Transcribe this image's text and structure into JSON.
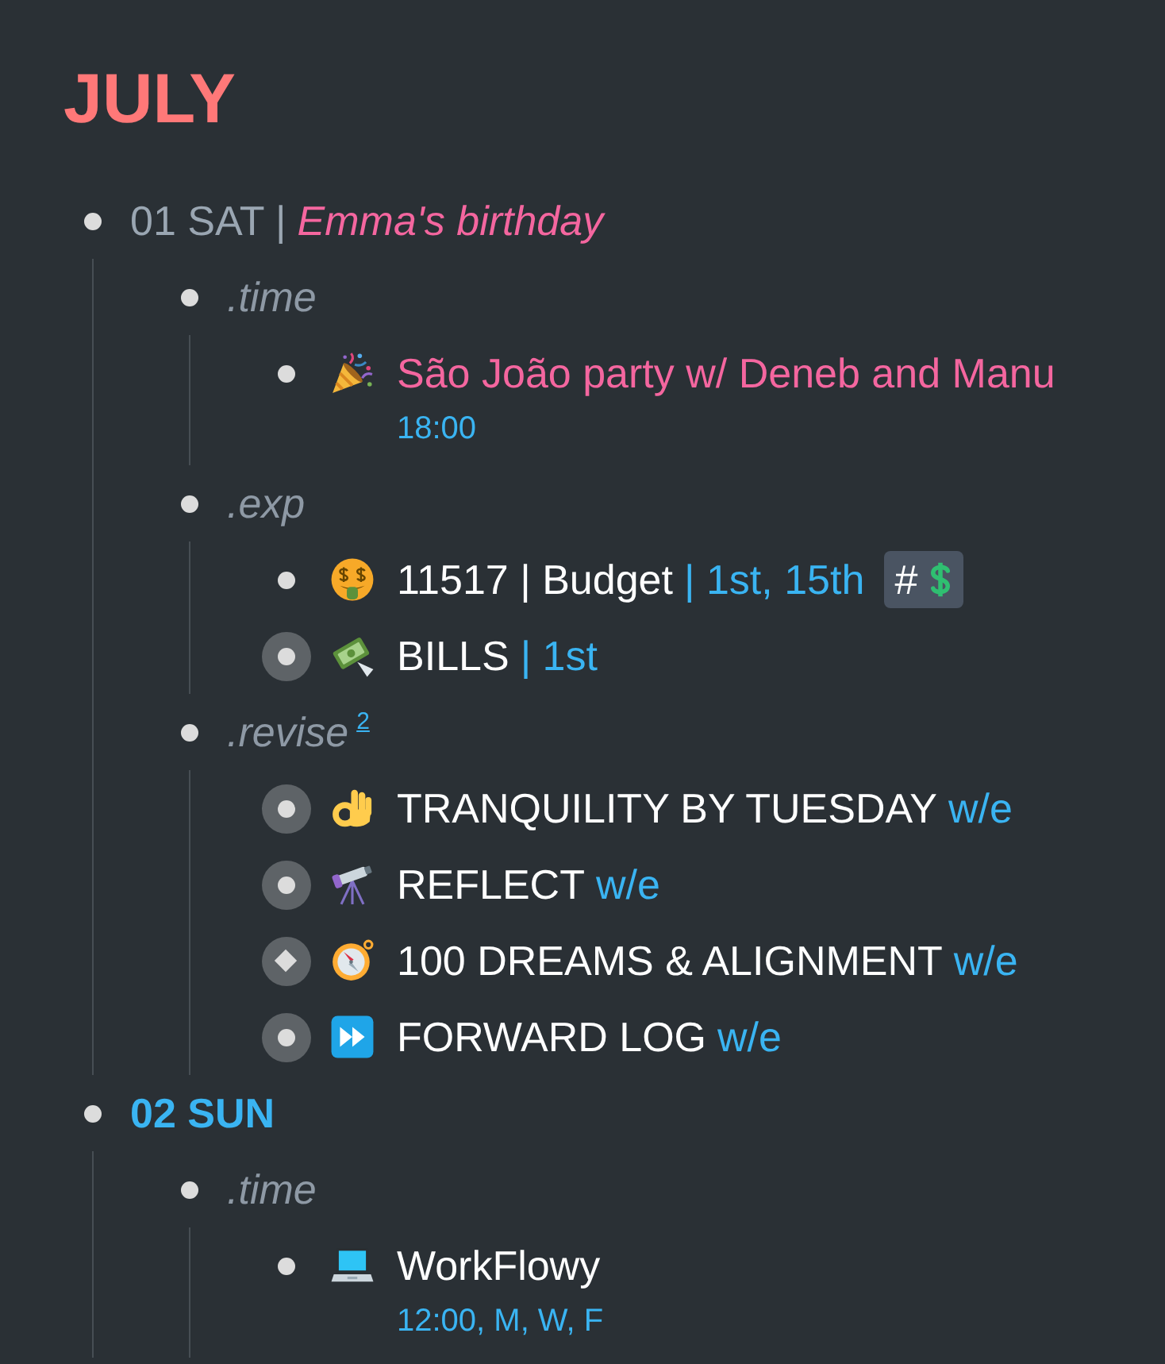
{
  "title": "JULY",
  "items": [
    {
      "kind": "plain",
      "collapsed": false,
      "segments": [
        {
          "kind": "text",
          "text": "01 SAT |",
          "color": "#9aa6b2"
        },
        {
          "kind": "emphasis",
          "text": "Emma's birthday",
          "color": "#f4669f"
        }
      ],
      "children": [
        {
          "kind": "plain",
          "collapsed": false,
          "segments": [
            {
              "kind": "emphasis",
              "text": ".time",
              "color": "#8e99a5"
            }
          ],
          "children": [
            {
              "kind": "plain",
              "collapsed": false,
              "segments": [
                {
                  "kind": "text",
                  "text": "São João party w/ Deneb and Manu",
                  "color": "#f4669f"
                }
              ],
              "note": "18:00"
            }
          ]
        },
        {
          "kind": "plain",
          "collapsed": false,
          "segments": [
            {
              "kind": "emphasis",
              "text": ".exp",
              "color": "#8e99a5"
            }
          ],
          "children": [
            {
              "kind": "plain",
              "collapsed": false,
              "segments": [
                {
                  "kind": "text",
                  "text": "11517 | Budget",
                  "color": "#ffffff"
                },
                {
                  "kind": "text",
                  "text": "| 1st, 15th",
                  "color": "#3ab4f2"
                },
                {
                  "kind": "tag",
                  "text": "#"
                }
              ]
            },
            {
              "kind": "plain",
              "collapsed": true,
              "segments": [
                {
                  "kind": "text",
                  "text": "BILLS",
                  "color": "#ffffff"
                },
                {
                  "kind": "text",
                  "text": "| 1st",
                  "color": "#3ab4f2"
                }
              ]
            }
          ]
        },
        {
          "kind": "plain",
          "collapsed": false,
          "segments": [
            {
              "kind": "emphasis",
              "text": ".revise",
              "color": "#8e99a5"
            },
            {
              "kind": "count",
              "text": "2",
              "color": "#3ab4f2"
            }
          ],
          "children": [
            {
              "kind": "plain",
              "collapsed": true,
              "segments": [
                {
                  "kind": "text",
                  "text": "TRANQUILITY BY TUESDAY",
                  "color": "#ffffff"
                },
                {
                  "kind": "text",
                  "text": "w/e",
                  "color": "#3ab4f2"
                }
              ]
            },
            {
              "kind": "plain",
              "collapsed": true,
              "segments": [
                {
                  "kind": "text",
                  "text": "REFLECT",
                  "color": "#ffffff"
                },
                {
                  "kind": "text",
                  "text": "w/e",
                  "color": "#3ab4f2"
                }
              ]
            },
            {
              "kind": "mirror",
              "collapsed": true,
              "segments": [
                {
                  "kind": "text",
                  "text": "100 DREAMS & ALIGNMENT",
                  "color": "#ffffff"
                },
                {
                  "kind": "text",
                  "text": "w/e",
                  "color": "#3ab4f2"
                }
              ]
            },
            {
              "kind": "plain",
              "collapsed": true,
              "segments": [
                {
                  "kind": "text",
                  "text": "FORWARD LOG",
                  "color": "#ffffff"
                },
                {
                  "kind": "text",
                  "text": "w/e",
                  "color": "#3ab4f2"
                }
              ]
            }
          ]
        }
      ]
    },
    {
      "kind": "plain",
      "collapsed": false,
      "segments": [
        {
          "kind": "strong",
          "text": "02 SUN",
          "color": "#3ab4f2"
        }
      ],
      "children": [
        {
          "kind": "plain",
          "collapsed": false,
          "segments": [
            {
              "kind": "emphasis",
              "text": ".time",
              "color": "#8e99a5"
            }
          ],
          "children": [
            {
              "kind": "plain",
              "collapsed": false,
              "segments": [
                {
                  "kind": "text",
                  "text": "WorkFlowy",
                  "color": "#ffffff"
                }
              ],
              "note": "12:00, M, W, F"
            }
          ]
        }
      ]
    }
  ]
}
